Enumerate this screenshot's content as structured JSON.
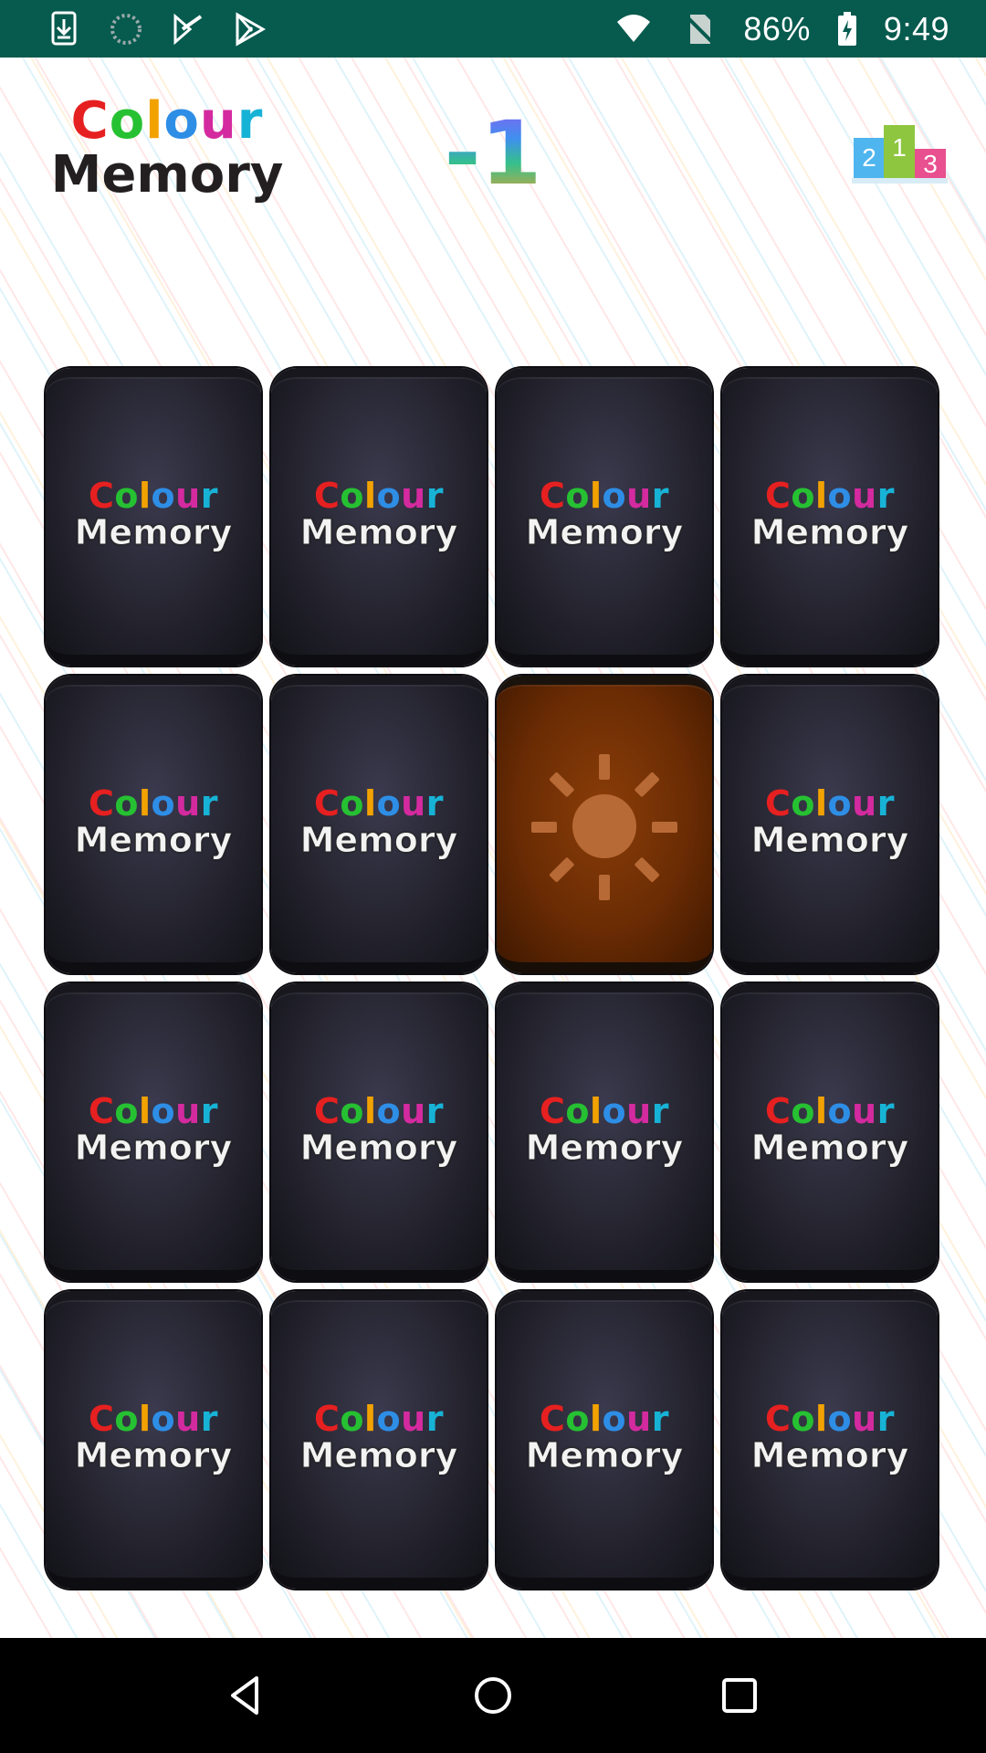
{
  "status_bar": {
    "battery": "86%",
    "time": "9:49",
    "icons": [
      "download-icon",
      "loading-icon",
      "google-play-store-icon",
      "google-play-icon",
      "wifi-icon",
      "no-sim-icon",
      "battery-charging-icon"
    ]
  },
  "header": {
    "logo_line1": "Colour",
    "logo_line2": "Memory",
    "score": "-1",
    "leaderboard_labels": [
      "2",
      "1",
      "3"
    ]
  },
  "cards": [
    {
      "state": "face-down",
      "logo_line1": "Colour",
      "logo_line2": "Memory"
    },
    {
      "state": "face-down",
      "logo_line1": "Colour",
      "logo_line2": "Memory"
    },
    {
      "state": "face-down",
      "logo_line1": "Colour",
      "logo_line2": "Memory"
    },
    {
      "state": "face-down",
      "logo_line1": "Colour",
      "logo_line2": "Memory"
    },
    {
      "state": "face-down",
      "logo_line1": "Colour",
      "logo_line2": "Memory"
    },
    {
      "state": "face-down",
      "logo_line1": "Colour",
      "logo_line2": "Memory"
    },
    {
      "state": "face-up",
      "icon": "sun-icon",
      "color": "#7a3306"
    },
    {
      "state": "face-down",
      "logo_line1": "Colour",
      "logo_line2": "Memory"
    },
    {
      "state": "face-down",
      "logo_line1": "Colour",
      "logo_line2": "Memory"
    },
    {
      "state": "face-down",
      "logo_line1": "Colour",
      "logo_line2": "Memory"
    },
    {
      "state": "face-down",
      "logo_line1": "Colour",
      "logo_line2": "Memory"
    },
    {
      "state": "face-down",
      "logo_line1": "Colour",
      "logo_line2": "Memory"
    },
    {
      "state": "face-down",
      "logo_line1": "Colour",
      "logo_line2": "Memory"
    },
    {
      "state": "face-down",
      "logo_line1": "Colour",
      "logo_line2": "Memory"
    },
    {
      "state": "face-down",
      "logo_line1": "Colour",
      "logo_line2": "Memory"
    },
    {
      "state": "face-down",
      "logo_line1": "Colour",
      "logo_line2": "Memory"
    }
  ],
  "nav_bar": {
    "buttons": [
      "back-icon",
      "home-icon",
      "recents-icon"
    ]
  },
  "colors": {
    "status_bar": "#065a4e",
    "card_back": "#2a2937",
    "revealed_card": "#7a3306"
  }
}
